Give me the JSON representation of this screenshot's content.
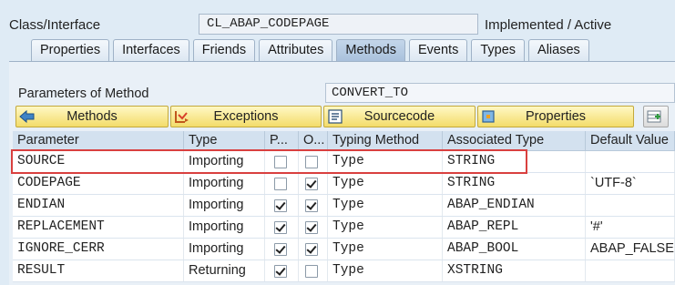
{
  "header": {
    "class_label": "Class/Interface",
    "class_value": "CL_ABAP_CODEPAGE",
    "status": "Implemented / Active"
  },
  "tabs": [
    {
      "label": "Properties",
      "active": false
    },
    {
      "label": "Interfaces",
      "active": false
    },
    {
      "label": "Friends",
      "active": false
    },
    {
      "label": "Attributes",
      "active": false
    },
    {
      "label": "Methods",
      "active": true
    },
    {
      "label": "Events",
      "active": false
    },
    {
      "label": "Types",
      "active": false
    },
    {
      "label": "Aliases",
      "active": false
    }
  ],
  "method": {
    "label": "Parameters of Method",
    "value": "CONVERT_TO"
  },
  "toolbar": {
    "methods_label": "Methods",
    "exceptions_label": "Exceptions",
    "sourcecode_label": "Sourcecode",
    "properties_label": "Properties"
  },
  "table": {
    "headers": {
      "parameter": "Parameter",
      "type": "Type",
      "p": "P...",
      "o": "O...",
      "typing": "Typing Method",
      "assoc": "Associated Type",
      "default": "Default Value"
    },
    "rows": [
      {
        "parameter": "SOURCE",
        "type": "Importing",
        "p": false,
        "o": false,
        "typing": "Type",
        "assoc": "STRING",
        "default": ""
      },
      {
        "parameter": "CODEPAGE",
        "type": "Importing",
        "p": false,
        "o": true,
        "typing": "Type",
        "assoc": "STRING",
        "default": "`UTF-8`"
      },
      {
        "parameter": "ENDIAN",
        "type": "Importing",
        "p": true,
        "o": true,
        "typing": "Type",
        "assoc": "ABAP_ENDIAN",
        "default": ""
      },
      {
        "parameter": "REPLACEMENT",
        "type": "Importing",
        "p": true,
        "o": true,
        "typing": "Type",
        "assoc": "ABAP_REPL",
        "default": "'#'"
      },
      {
        "parameter": "IGNORE_CERR",
        "type": "Importing",
        "p": true,
        "o": true,
        "typing": "Type",
        "assoc": "ABAP_BOOL",
        "default": "ABAP_FALSE"
      },
      {
        "parameter": "RESULT",
        "type": "Returning",
        "p": true,
        "o": false,
        "typing": "Type",
        "assoc": "XSTRING",
        "default": ""
      }
    ]
  },
  "colors": {
    "highlight": "#d9403f",
    "button_yellow": "#f3dc6a",
    "panel_bg": "#e9f0f7"
  }
}
